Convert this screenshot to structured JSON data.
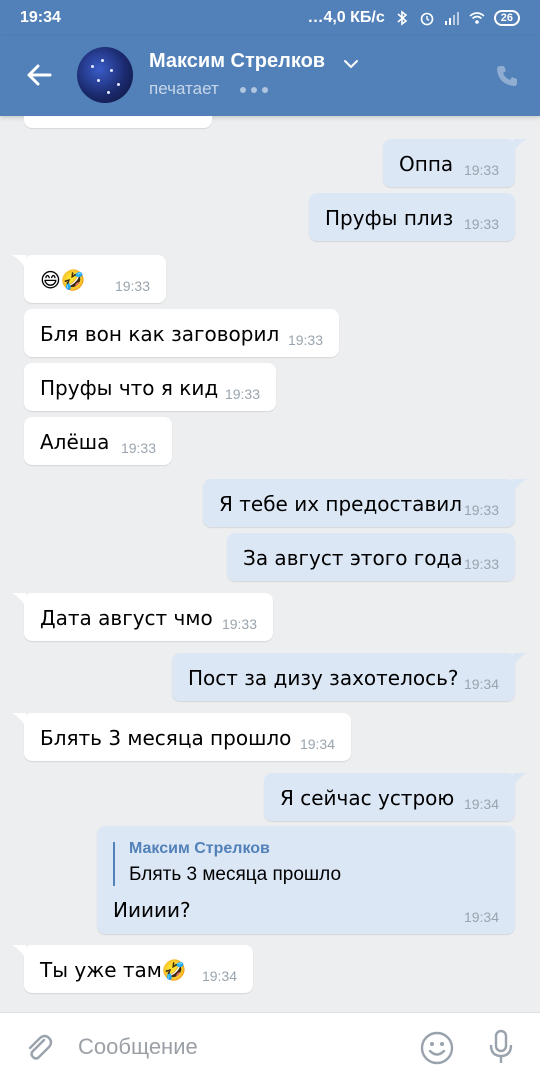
{
  "status_bar": {
    "time": "19:34",
    "network_speed": "4,0 КБ/с",
    "battery": "26"
  },
  "header": {
    "contact_name": "Максим Стрелков",
    "status": "печатает"
  },
  "messages": [
    {
      "dir": "out",
      "text": "Оппа",
      "time": "19:33"
    },
    {
      "dir": "out",
      "text": "Пруфы плиз",
      "time": "19:33"
    },
    {
      "dir": "in",
      "text": "😄🤣",
      "time": "19:33"
    },
    {
      "dir": "in",
      "text": "Бля вон как заговорил",
      "time": "19:33"
    },
    {
      "dir": "in",
      "text": "Пруфы что я кид",
      "time": "19:33"
    },
    {
      "dir": "in",
      "text": "Алёша",
      "time": "19:33"
    },
    {
      "dir": "out",
      "text": "Я тебе их предоставил",
      "time": "19:33"
    },
    {
      "dir": "out",
      "text": "За август этого года",
      "time": "19:33"
    },
    {
      "dir": "in",
      "text": "Дата август чмо",
      "time": "19:33"
    },
    {
      "dir": "out",
      "text": "Пост за дизу захотелось?",
      "time": "19:34"
    },
    {
      "dir": "in",
      "text": "Блять 3 месяца прошло",
      "time": "19:34"
    },
    {
      "dir": "out",
      "text": "Я сейчас устрою",
      "time": "19:34"
    },
    {
      "dir": "out",
      "reply_name": "Максим Стрелков",
      "reply_text": "Блять 3 месяца прошло",
      "text": "Иииии?",
      "time": "19:34"
    },
    {
      "dir": "in",
      "text": "Ты уже там🤣",
      "time": "19:34"
    }
  ],
  "input": {
    "placeholder": "Сообщение"
  },
  "colors": {
    "header": "#5181b8",
    "chat_background": "#edeef0",
    "incoming_bubble": "#ffffff",
    "outgoing_bubble": "#dce7f6"
  },
  "icons": {
    "back": "arrow-left-icon",
    "call": "phone-icon",
    "attach": "paperclip-icon",
    "emoji": "smiley-icon",
    "mic": "microphone-icon"
  }
}
